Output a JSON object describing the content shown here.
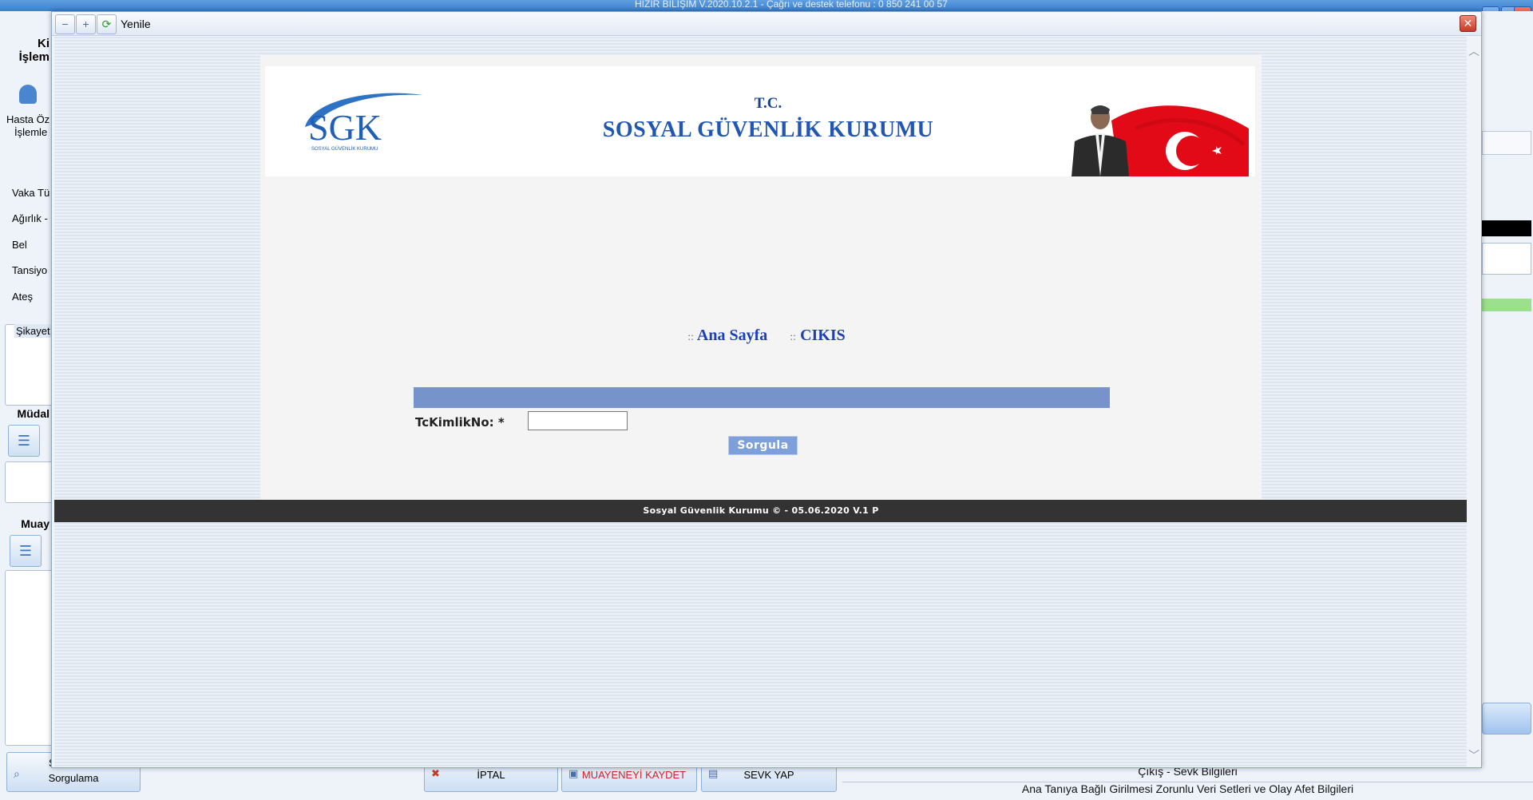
{
  "background_app": {
    "title": "HIZIR BİLİŞİM V.2020.10.2.1 - Çağrı ve destek telefonu : 0 850 241 00 57",
    "left_panel": {
      "heading_1_line1": "Ki",
      "heading_1_line2": "İşlem",
      "patient_ops_label_line1": "Hasta Öz",
      "patient_ops_label_line2": "İşlemle",
      "fields": [
        "Vaka Tü",
        "Ağırlık -",
        "Bel",
        "Tansiyo",
        "Ateş"
      ],
      "complaint_tab": "Şikayet",
      "section_2": "Müdal",
      "section_3": "Muay",
      "query_button_line1": "S",
      "query_button_line2": "Sorgulama"
    },
    "bottom_buttons": {
      "cancel": "İPTAL",
      "save_exam": "MUAYENEYİ KAYDET",
      "referral": "SEVK YAP"
    },
    "status": {
      "line1": "Çıkış - Sevk Bilgileri",
      "line2": "Ana Tanıya Bağlı Girilmesi Zorunlu Veri Setleri ve Olay Afet Bilgileri"
    }
  },
  "dialog": {
    "toolbar_label": "Yenile",
    "close_symbol": "✕"
  },
  "sgk": {
    "logo_text": "SGK",
    "logo_subtext": "SOSYAL GÜVENLİK KURUMU",
    "tc": "T.C.",
    "title": "SOSYAL GÜVENLİK KURUMU",
    "nav": [
      {
        "prefix": "::",
        "label": "Ana Sayfa"
      },
      {
        "prefix": "::",
        "label": "CIKIS"
      }
    ],
    "form": {
      "label": "TcKimlikNo: *",
      "input_value": "",
      "submit": "Sorgula"
    },
    "footer": "Sosyal Güvenlik Kurumu © - 05.06.2020 V.1 P"
  },
  "colors": {
    "sgk_blue": "#2157b0",
    "nav_link": "#1d3fb8",
    "form_bar": "#7694cb",
    "submit_bg": "#7da0da",
    "footer_bg": "#333333",
    "flag_red": "#e30a17"
  },
  "icons": {
    "toolbar": [
      "page-zoom-out-icon",
      "page-zoom-in-icon",
      "refresh-icon"
    ],
    "close": "close-icon",
    "scroll_up": "chevron-up-icon",
    "scroll_down": "chevron-down-icon"
  }
}
